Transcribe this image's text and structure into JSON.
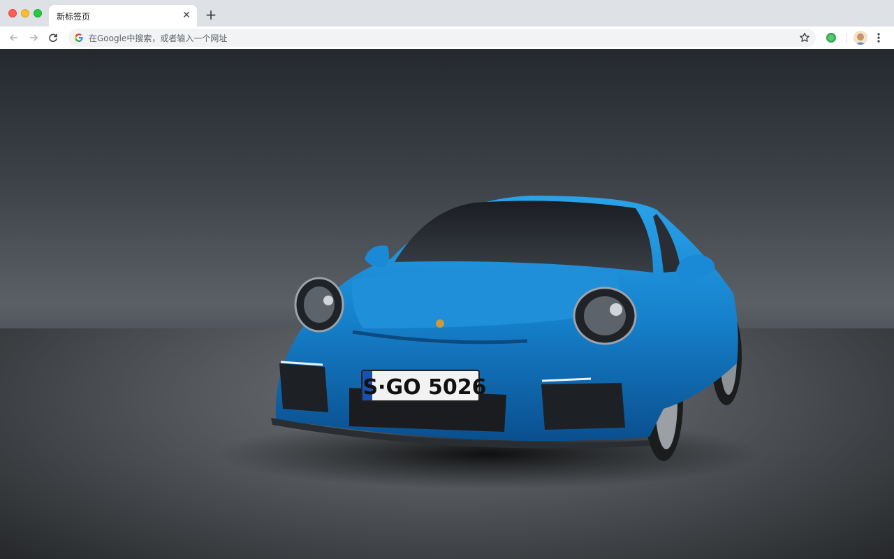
{
  "window": {
    "controls": [
      "close",
      "minimize",
      "zoom"
    ]
  },
  "tabs": [
    {
      "title": "新标签页",
      "active": true
    }
  ],
  "toolbar": {
    "back_icon": "arrow-left-icon",
    "forward_icon": "arrow-right-icon",
    "reload_icon": "reload-icon",
    "omnibox": {
      "placeholder": "在Google中搜索，或者输入一个网址",
      "engine_icon": "google-g-icon"
    },
    "bookmark_icon": "star-icon",
    "extension_icon": "green-circle-extension-icon",
    "profile_icon": "avatar-icon",
    "menu_icon": "kebab-menu-icon"
  },
  "wallpaper": {
    "subject": "blue sports car",
    "license_plate": "S·GO 5026",
    "accent_color": "#1a8fd6"
  }
}
